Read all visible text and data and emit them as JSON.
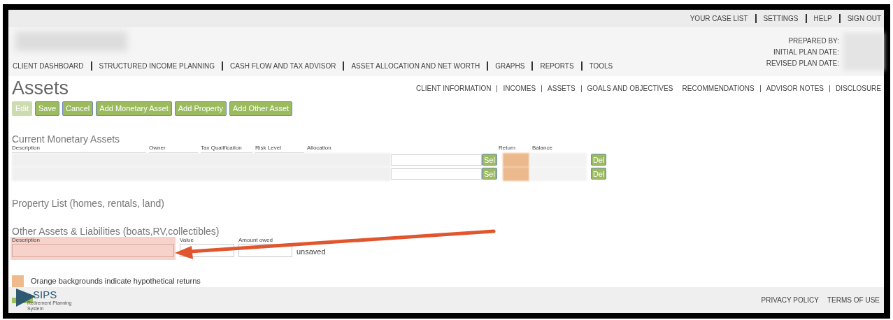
{
  "top_links": [
    "YOUR CASE LIST",
    "SETTINGS",
    "HELP",
    "SIGN OUT"
  ],
  "main_nav": [
    "CLIENT DASHBOARD",
    "STRUCTURED INCOME PLANNING",
    "CASH FLOW AND TAX ADVISOR",
    "ASSET ALLOCATION AND NET WORTH",
    "GRAPHS",
    "REPORTS",
    "TOOLS"
  ],
  "plan_info": [
    "PREPARED BY:",
    "INITIAL PLAN DATE:",
    "REVISED PLAN DATE:"
  ],
  "page_title": "Assets",
  "sub_nav_left": [
    "CLIENT INFORMATION",
    "INCOMES",
    "ASSETS",
    "GOALS AND OBJECTIVES"
  ],
  "sub_nav_right": [
    "RECOMMENDATIONS",
    "ADVISOR NOTES",
    "DISCLOSURE"
  ],
  "toolbar": [
    {
      "label": "Edit",
      "disabled": true
    },
    {
      "label": "Save",
      "disabled": false
    },
    {
      "label": "Cancel",
      "disabled": false
    },
    {
      "label": "Add Monetary Asset",
      "disabled": false
    },
    {
      "label": "Add Property",
      "disabled": false
    },
    {
      "label": "Add Other Asset",
      "disabled": false
    }
  ],
  "monetary_assets": {
    "title": "Current Monetary Assets",
    "columns": [
      "Description",
      "Owner",
      "Tax Qualification",
      "Risk Level",
      "Allocation",
      "Return",
      "Balance"
    ],
    "rows": [
      {
        "select_button": "Sel",
        "hypothetical": true,
        "delete_button": "Del"
      },
      {
        "select_button": "Sel",
        "hypothetical": true,
        "delete_button": "Del"
      }
    ]
  },
  "property_list": {
    "title": "Property List (homes, rentals, land)"
  },
  "other_assets": {
    "title": "Other Assets & Liabilities (boats,RV,collectibles)",
    "fields": [
      {
        "label": "Description",
        "highlighted": true
      },
      {
        "label": "Value",
        "highlighted": false
      },
      {
        "label": "Amount owed",
        "highlighted": false
      }
    ],
    "status": "unsaved"
  },
  "legend": "Orange backgrounds indicate hypothetical returns",
  "footer": {
    "logo_text": "SIPS",
    "logo_subtitle": "Retirement Planning System",
    "links": [
      "PRIVACY POLICY",
      "TERMS OF USE"
    ]
  }
}
